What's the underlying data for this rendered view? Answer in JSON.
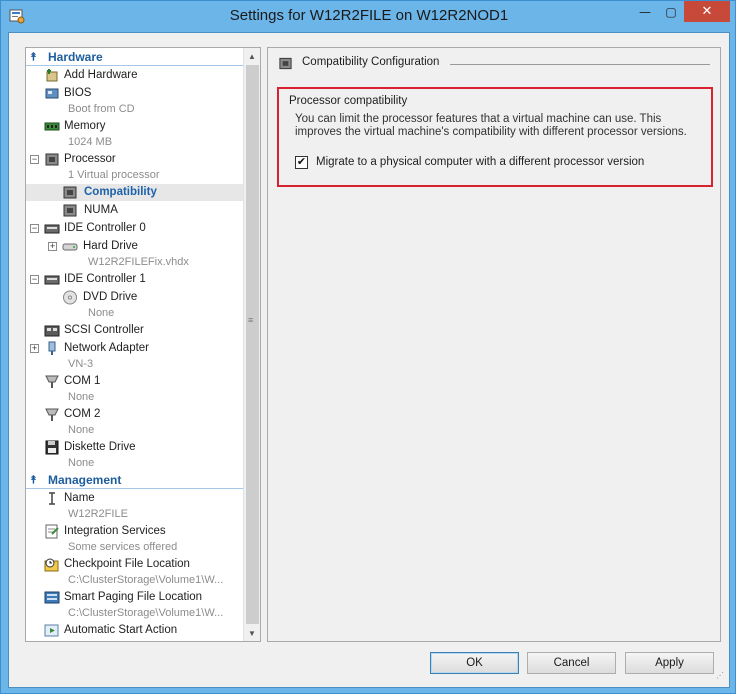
{
  "window": {
    "title": "Settings for W12R2FILE on W12R2NOD1",
    "buttons": {
      "minimize": "—",
      "maximize": "▢",
      "close": "✕"
    }
  },
  "tree": {
    "hardware_section": "Hardware",
    "management_section": "Management",
    "hardware_items": [
      {
        "label": "Add Hardware",
        "icon": "add-hardware-icon"
      },
      {
        "label": "BIOS",
        "sub": "Boot from CD",
        "icon": "bios-icon"
      },
      {
        "label": "Memory",
        "sub": "1024 MB",
        "icon": "memory-icon"
      },
      {
        "label": "Processor",
        "sub": "1 Virtual processor",
        "icon": "processor-icon"
      },
      {
        "label": "Compatibility",
        "icon": "compatibility-icon"
      },
      {
        "label": "NUMA",
        "icon": "numa-icon"
      },
      {
        "label": "IDE Controller 0",
        "icon": "ide-controller-icon"
      },
      {
        "label": "Hard Drive",
        "sub": "W12R2FILEFix.vhdx",
        "icon": "hard-drive-icon"
      },
      {
        "label": "IDE Controller 1",
        "icon": "ide-controller-icon"
      },
      {
        "label": "DVD Drive",
        "sub": "None",
        "icon": "dvd-drive-icon"
      },
      {
        "label": "SCSI Controller",
        "icon": "scsi-controller-icon"
      },
      {
        "label": "Network Adapter",
        "sub": "VN-3",
        "icon": "network-adapter-icon"
      },
      {
        "label": "COM 1",
        "sub": "None",
        "icon": "com-port-icon"
      },
      {
        "label": "COM 2",
        "sub": "None",
        "icon": "com-port-icon"
      },
      {
        "label": "Diskette Drive",
        "sub": "None",
        "icon": "diskette-drive-icon"
      }
    ],
    "management_items": [
      {
        "label": "Name",
        "sub": "W12R2FILE",
        "icon": "name-icon"
      },
      {
        "label": "Integration Services",
        "sub": "Some services offered",
        "icon": "integration-services-icon"
      },
      {
        "label": "Checkpoint File Location",
        "sub": "C:\\ClusterStorage\\Volume1\\W...",
        "icon": "checkpoint-icon"
      },
      {
        "label": "Smart Paging File Location",
        "sub": "C:\\ClusterStorage\\Volume1\\W...",
        "icon": "smart-paging-icon"
      },
      {
        "label": "Automatic Start Action",
        "icon": "automatic-start-icon"
      }
    ],
    "selected": "Compatibility"
  },
  "details": {
    "header": "Compatibility Configuration",
    "group_title": "Processor compatibility",
    "description": "You can limit the processor features that a virtual machine can use. This improves the virtual machine's compatibility with different processor versions.",
    "checkbox_label": "Migrate to a physical computer with a different processor version",
    "checkbox_checked": true
  },
  "buttons": {
    "ok": "OK",
    "cancel": "Cancel",
    "apply": "Apply"
  },
  "colors": {
    "accent": "#1d62aa",
    "highlight_box": "#d7232f",
    "window_frame": "#6cb5e8"
  }
}
